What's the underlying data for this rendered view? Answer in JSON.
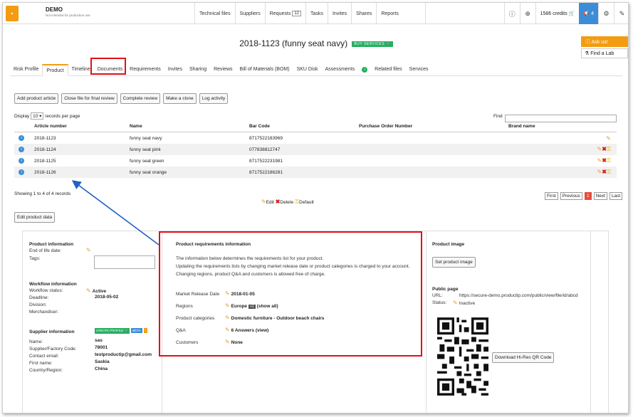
{
  "app": {
    "name": "DEMO",
    "subtitle": "Not intended for production use"
  },
  "topnav": {
    "technical_files": "Technical files",
    "suppliers": "Suppliers",
    "requests": "Requests",
    "requests_count": "12",
    "tasks": "Tasks",
    "invites": "Invites",
    "shares": "Shares",
    "reports": "Reports"
  },
  "topright": {
    "credits": "1586 credits",
    "notifications": "4"
  },
  "page": {
    "title": "2018-1123 (funny seat navy)",
    "buy_services": "BUY SERVICES",
    "ask_us": "Ask us!",
    "find_lab": "Find a Lab"
  },
  "tabs": [
    "Risk Profile",
    "Product",
    "Timeline",
    "Documents",
    "Requirements",
    "Invites",
    "Sharing",
    "Reviews",
    "Bill of Materials (BOM)",
    "SKU Disk",
    "Assessments",
    "Related files",
    "Services"
  ],
  "actions": {
    "add_article": "Add product article",
    "close_file": "Close file for final review",
    "complete_review": "Complete review",
    "make_clone": "Make a clone",
    "log_activity": "Log activity"
  },
  "table_controls": {
    "display_prefix": "Display",
    "page_size": "10",
    "display_suffix": "records per page",
    "find_label": "Find"
  },
  "table": {
    "headers": [
      "Article number",
      "Name",
      "Bar Code",
      "Purchase Order Number",
      "Brand name"
    ],
    "rows": [
      {
        "article": "2018-1123",
        "name": "funny seat navy",
        "barcode": "8717522183969",
        "po": "",
        "brand": ""
      },
      {
        "article": "2018-1124",
        "name": "funny seat pink",
        "barcode": "077838812747",
        "po": "",
        "brand": ""
      },
      {
        "article": "2018-1125",
        "name": "funny seat green",
        "barcode": "8717522231981",
        "po": "",
        "brand": ""
      },
      {
        "article": "2018-1126",
        "name": "funny seat orange",
        "barcode": "8717522186281",
        "po": "",
        "brand": ""
      }
    ],
    "showing": "Showing 1 to 4 of 4 records",
    "legend_edit": "Edit",
    "legend_delete": "Delete",
    "legend_default": "Default",
    "pager": {
      "first": "First",
      "previous": "Previous",
      "current": "1",
      "next": "Next",
      "last": "Last"
    }
  },
  "edit_product_data": "Edit product data",
  "product_info": {
    "heading": "Product information",
    "end_of_life_label": "End of life date:",
    "tags_label": "Tags:"
  },
  "workflow_info": {
    "heading": "Workflow information",
    "status_label": "Workflow status:",
    "status_value": "Active",
    "deadline_label": "Deadline:",
    "deadline_value": "2018-05-02",
    "division_label": "Division:",
    "merchandiser_label": "Merchandiser:"
  },
  "supplier_info": {
    "heading": "Supplier information",
    "create_profile": "CREATE PROFILE",
    "beta": "BETA",
    "name_label": "Name:",
    "name_value": "sas",
    "code_label": "Supplier/Factory Code:",
    "code_value": "78001",
    "email_label": "Contact email:",
    "email_value": "testproductip@gmail.com",
    "first_name_label": "First name:",
    "first_name_value": "Saskia",
    "country_label": "Country/Region:",
    "country_value": "China"
  },
  "requirements_info": {
    "heading": "Product requirements information",
    "desc1": "The information below determines the requirements list for your product.",
    "desc2": "Updating the requirements lists by changing market release date or product categories is charged to your account.",
    "desc3": "Changing regions, product Q&A and customers is allowed free of charge.",
    "release_label": "Market Release Date",
    "release_value": "2018-01-05",
    "regions_label": "Regions",
    "regions_value": "Europe",
    "regions_count": "+1",
    "regions_show": "(show all)",
    "categories_label": "Product categories",
    "categories_value": "Domestic furniture - Outdoor beach chairs",
    "qa_label": "Q&A",
    "qa_value": "6 Answers",
    "qa_view": "(view)",
    "customers_label": "Customers",
    "customers_value": "None"
  },
  "product_image": {
    "heading": "Product image",
    "set_button": "Set product image",
    "public_heading": "Public page",
    "url_label": "URL:",
    "url_value": "https://secure-demo.productip.com/public/view/file/id/abcd",
    "status_label": "Status:",
    "status_value": "Inactive",
    "download_qr": "Download Hi-Res QR Code"
  },
  "colors": {
    "accent_orange": "#f39c12",
    "highlight_red": "#e0101a",
    "annotation_blue": "#2060c8",
    "green": "#27ae60",
    "blue": "#3c8dd8"
  }
}
